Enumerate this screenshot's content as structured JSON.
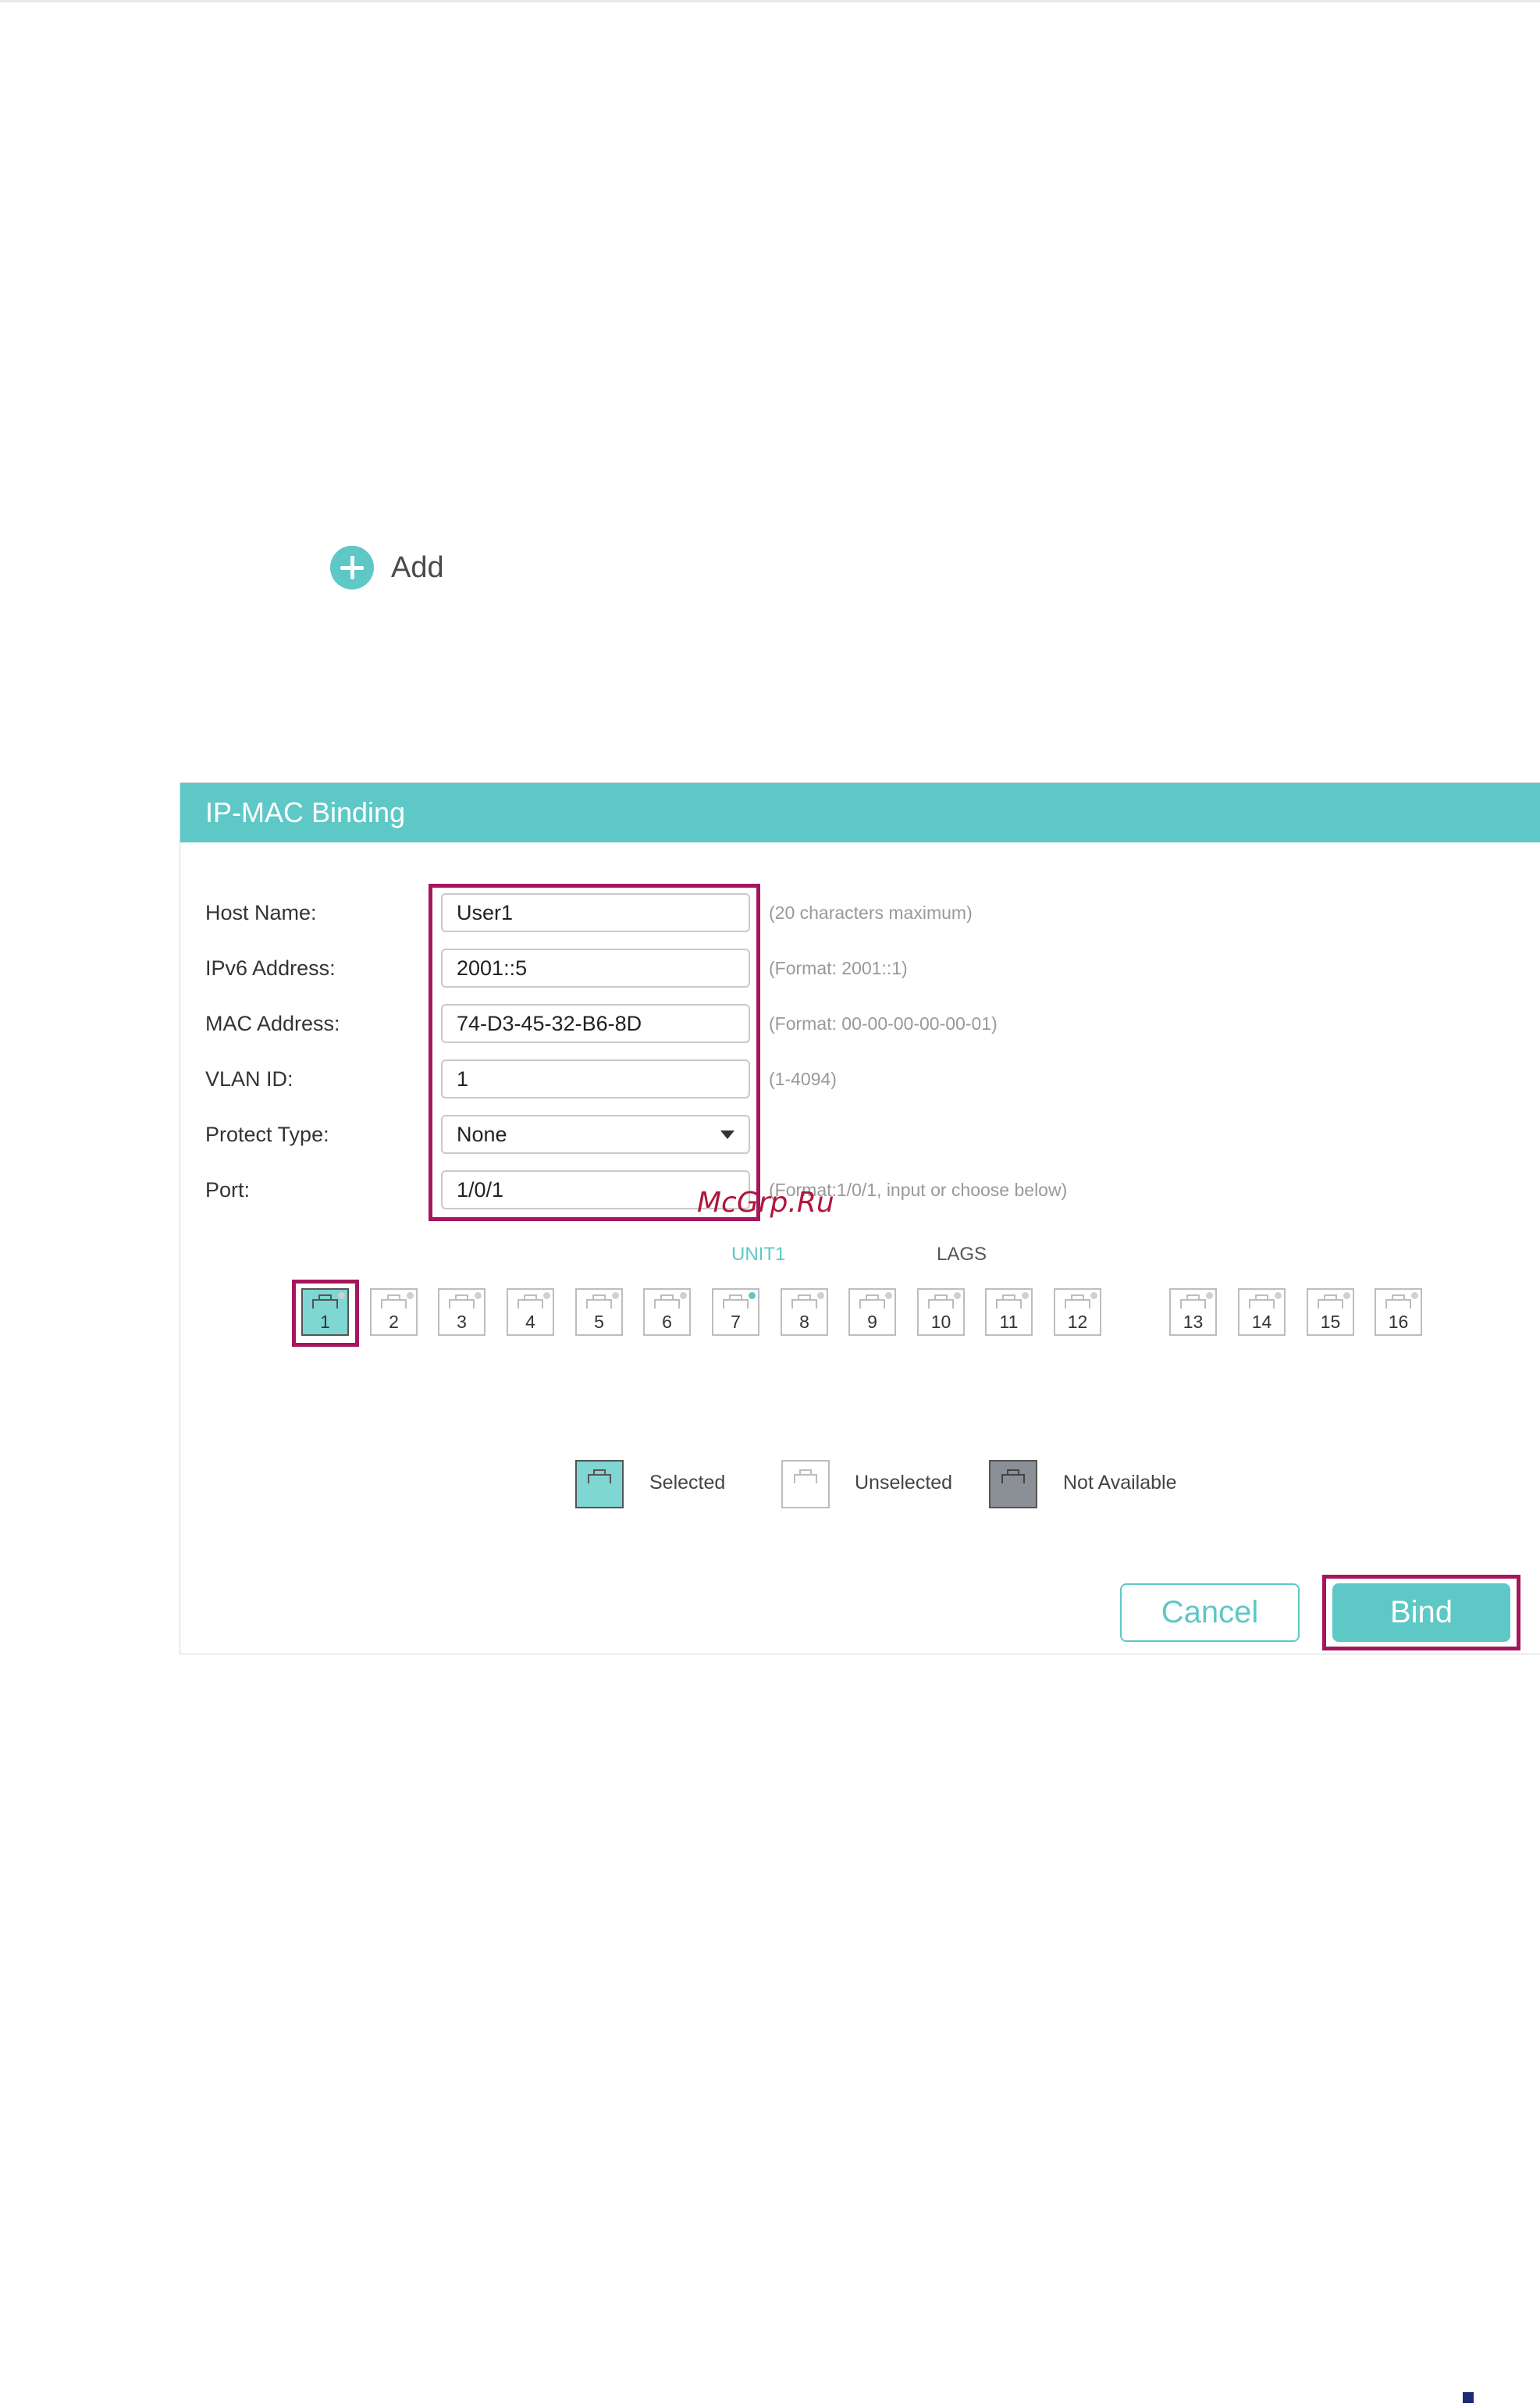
{
  "add": {
    "label": "Add",
    "icon": "plus-circle-icon"
  },
  "dialog": {
    "title": "IP-MAC Binding",
    "fields": {
      "host_name": {
        "label": "Host Name:",
        "value": "User1",
        "hint": "(20 characters maximum)"
      },
      "ipv6": {
        "label": "IPv6 Address:",
        "value": "2001::5",
        "hint": "(Format: 2001::1)"
      },
      "mac": {
        "label": "MAC Address:",
        "value": "74-D3-45-32-B6-8D",
        "hint": "(Format: 00-00-00-00-00-01)"
      },
      "vlan": {
        "label": "VLAN ID:",
        "value": "1",
        "hint": "(1-4094)"
      },
      "protect_type": {
        "label": "Protect Type:",
        "value": "None"
      },
      "port": {
        "label": "Port:",
        "value": "1/0/1",
        "hint": "(Format:1/0/1, input or choose below)"
      }
    },
    "port_tabs": {
      "unit": "UNIT1",
      "lags": "LAGS"
    },
    "ports": [
      {
        "num": "1",
        "state": "selected"
      },
      {
        "num": "2",
        "state": "unselected"
      },
      {
        "num": "3",
        "state": "unselected"
      },
      {
        "num": "4",
        "state": "unselected"
      },
      {
        "num": "5",
        "state": "unselected"
      },
      {
        "num": "6",
        "state": "unselected"
      },
      {
        "num": "7",
        "state": "unselected",
        "link": "up"
      },
      {
        "num": "8",
        "state": "unselected"
      },
      {
        "num": "9",
        "state": "unselected"
      },
      {
        "num": "10",
        "state": "unselected"
      },
      {
        "num": "11",
        "state": "unselected"
      },
      {
        "num": "12",
        "state": "unselected"
      },
      {
        "num": "13",
        "state": "unselected"
      },
      {
        "num": "14",
        "state": "unselected"
      },
      {
        "num": "15",
        "state": "unselected"
      },
      {
        "num": "16",
        "state": "unselected"
      }
    ],
    "legend": {
      "selected": "Selected",
      "unselected": "Unselected",
      "not_available": "Not Available"
    },
    "buttons": {
      "cancel": "Cancel",
      "bind": "Bind"
    }
  },
  "watermark": "McGrp.Ru",
  "colors": {
    "accent": "#5ec8c6",
    "highlight": "#a5165c",
    "not_available": "#8b8f96"
  }
}
